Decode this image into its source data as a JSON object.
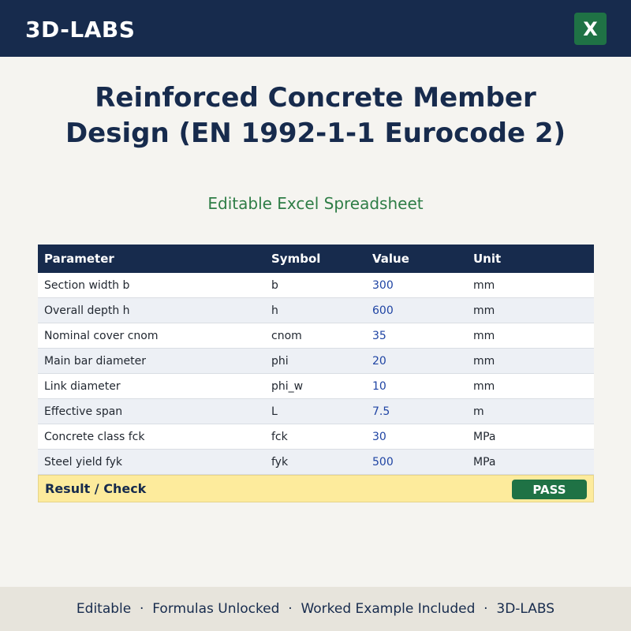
{
  "header": {
    "brand": "3D-LABS",
    "excel_icon_letter": "X",
    "excel_icon_name": "excel-icon",
    "background_color": "#172b4d",
    "excel_color": "#1f7245"
  },
  "hero": {
    "title": "Reinforced Concrete Member Design (EN 1992-1-1 Eurocode 2)",
    "subtitle": "Editable Excel Spreadsheet"
  },
  "table": {
    "columns": [
      "Parameter",
      "Symbol",
      "Value",
      "Unit"
    ],
    "rows": [
      {
        "parameter": "Section width b",
        "symbol": "b",
        "value": "300",
        "unit": "mm"
      },
      {
        "parameter": "Overall depth h",
        "symbol": "h",
        "value": "600",
        "unit": "mm"
      },
      {
        "parameter": "Nominal cover cnom",
        "symbol": "cnom",
        "value": "35",
        "unit": "mm"
      },
      {
        "parameter": "Main bar diameter",
        "symbol": "phi",
        "value": "20",
        "unit": "mm"
      },
      {
        "parameter": "Link diameter",
        "symbol": "phi_w",
        "value": "10",
        "unit": "mm"
      },
      {
        "parameter": "Effective span",
        "symbol": "L",
        "value": "7.5",
        "unit": "m"
      },
      {
        "parameter": "Concrete class fck",
        "symbol": "fck",
        "value": "30",
        "unit": "MPa"
      },
      {
        "parameter": "Steel yield fyk",
        "symbol": "fyk",
        "value": "500",
        "unit": "MPa"
      }
    ],
    "result": {
      "label": "Result / Check",
      "status": "PASS",
      "status_color": "#1f7245"
    }
  },
  "footer": {
    "text": "Editable  ·  Formulas Unlocked  ·  Worked Example Included  ·  3D-LABS"
  }
}
